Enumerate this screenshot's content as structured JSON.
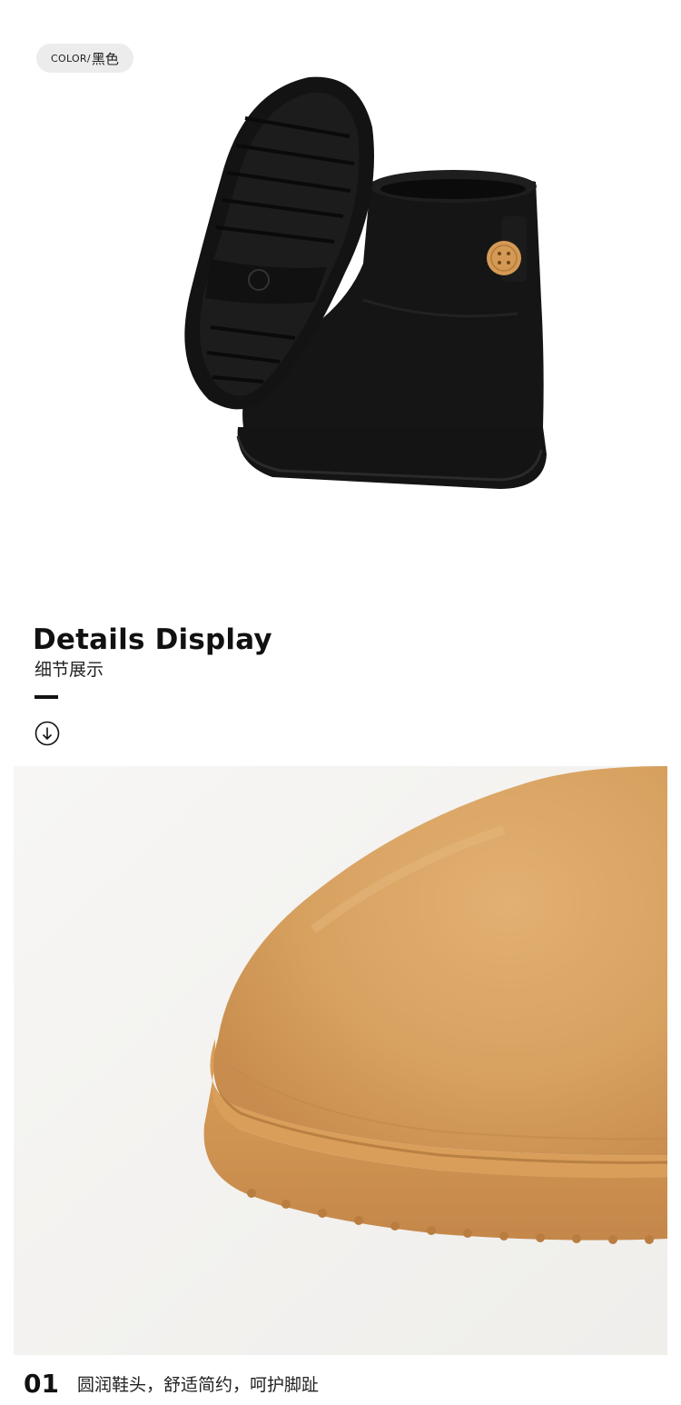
{
  "color_tag": {
    "prefix": "COLOR/",
    "value": "黑色"
  },
  "details": {
    "title": "Details Display",
    "subtitle": "细节展示"
  },
  "icons": {
    "scroll_down": "arrow-down-circle-icon"
  },
  "feature": {
    "number": "01",
    "text": "圆润鞋头，舒适简约，呵护脚趾"
  },
  "colors": {
    "boot_black": "#121212",
    "boot_tan": "#d9a461",
    "sole_tan": "#cf9650",
    "pill_bg": "#ececec",
    "text_dark": "#111111"
  }
}
